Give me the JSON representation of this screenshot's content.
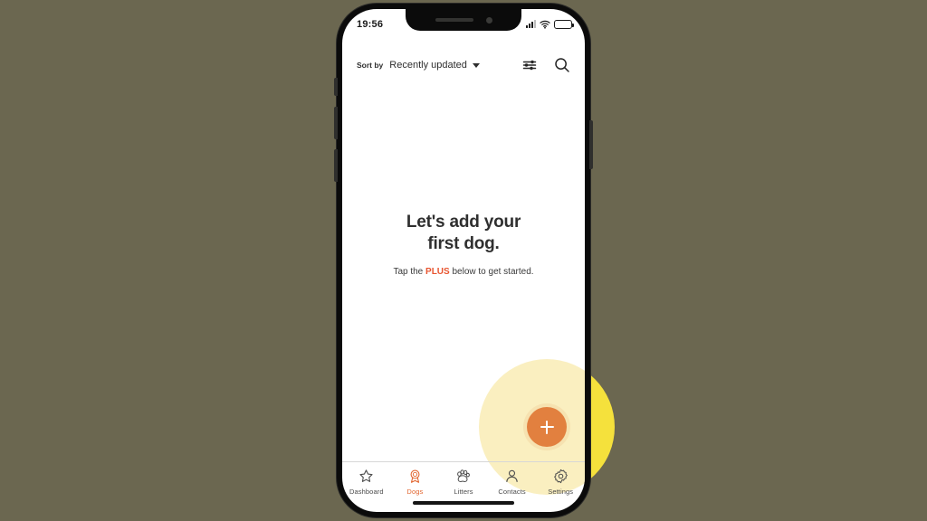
{
  "background": {
    "color": "#6b6750"
  },
  "phone": {
    "frame_color": "#0b0b0b",
    "buttons": [
      {
        "name": "mute-switch"
      },
      {
        "name": "volume-up-button"
      },
      {
        "name": "volume-down-button"
      },
      {
        "name": "power-button"
      }
    ]
  },
  "status_bar": {
    "time": "19:56",
    "signal_icon": "cellular-signal-icon",
    "wifi_icon": "wifi-icon",
    "battery_icon": "battery-low-power-icon",
    "battery_color": "#f5c518",
    "battery_level_percent": 45
  },
  "toolbar": {
    "sort_by_label": "Sort by",
    "sort_value": "Recently updated",
    "caret_icon": "chevron-down-icon",
    "filter_icon": "filter-sliders-icon",
    "search_icon": "search-icon"
  },
  "empty_state": {
    "heading": "Let's add your\nfirst dog.",
    "subtitle_before": "Tap the ",
    "subtitle_highlight": "PLUS",
    "subtitle_after": " below to get started.",
    "highlight_color": "#e8542f"
  },
  "fab": {
    "icon": "plus-icon",
    "label": "Add dog",
    "color": "#e2803f",
    "glow_inner_color": "#faefc0",
    "glow_outer_color": "#f5e13c"
  },
  "tab_bar": {
    "active_index": 1,
    "active_color": "#e2652f",
    "inactive_color": "#4b4b4b",
    "tabs": [
      {
        "label": "Dashboard",
        "icon": "star-icon"
      },
      {
        "label": "Dogs",
        "icon": "award-ribbon-icon"
      },
      {
        "label": "Litters",
        "icon": "paw-print-icon"
      },
      {
        "label": "Contacts",
        "icon": "person-icon"
      },
      {
        "label": "Settings",
        "icon": "gear-icon"
      }
    ]
  },
  "home_indicator": {
    "name": "home-indicator"
  }
}
